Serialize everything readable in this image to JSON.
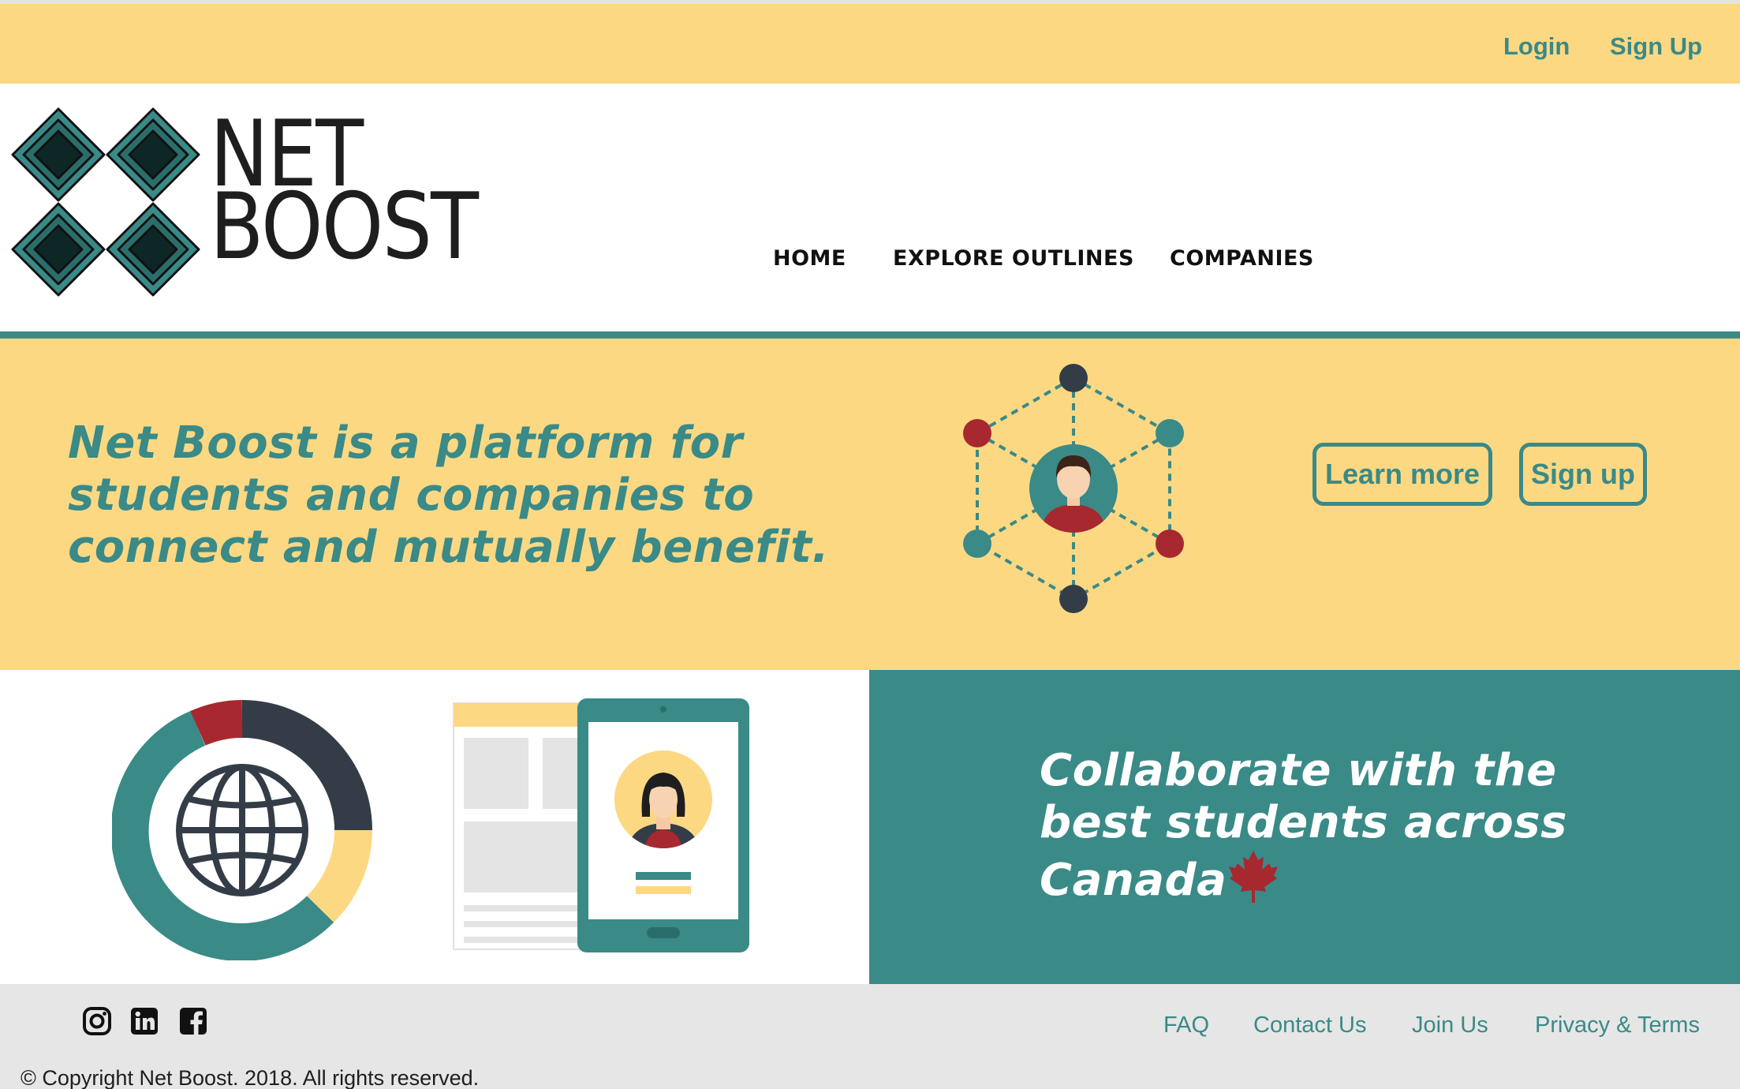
{
  "topbar": {
    "login": "Login",
    "signup": "Sign Up"
  },
  "brand": {
    "line1": "NET",
    "line2": "BOOST"
  },
  "nav": {
    "home": "HOME",
    "explore": "EXPLORE OUTLINES",
    "companies": "COMPANIES"
  },
  "hero": {
    "lines": [
      "Net Boost is a platform for",
      "students and companies to",
      "connect and mutually benefit."
    ],
    "learn_more": "Learn more",
    "sign_up": "Sign up"
  },
  "collab": {
    "lines": [
      "Collaborate with the",
      "best students across",
      "Canada"
    ]
  },
  "footer": {
    "social": [
      "instagram-icon",
      "linkedin-icon",
      "facebook-icon"
    ],
    "links": [
      "FAQ",
      "Contact Us",
      "Join Us",
      "Privacy & Terms"
    ],
    "copyright": "© Copyright Net Boost. 2018. All rights reserved."
  },
  "colors": {
    "yellow": "#fcd883",
    "teal": "#3a8a87",
    "dark": "#343d47",
    "red": "#a8282f"
  }
}
